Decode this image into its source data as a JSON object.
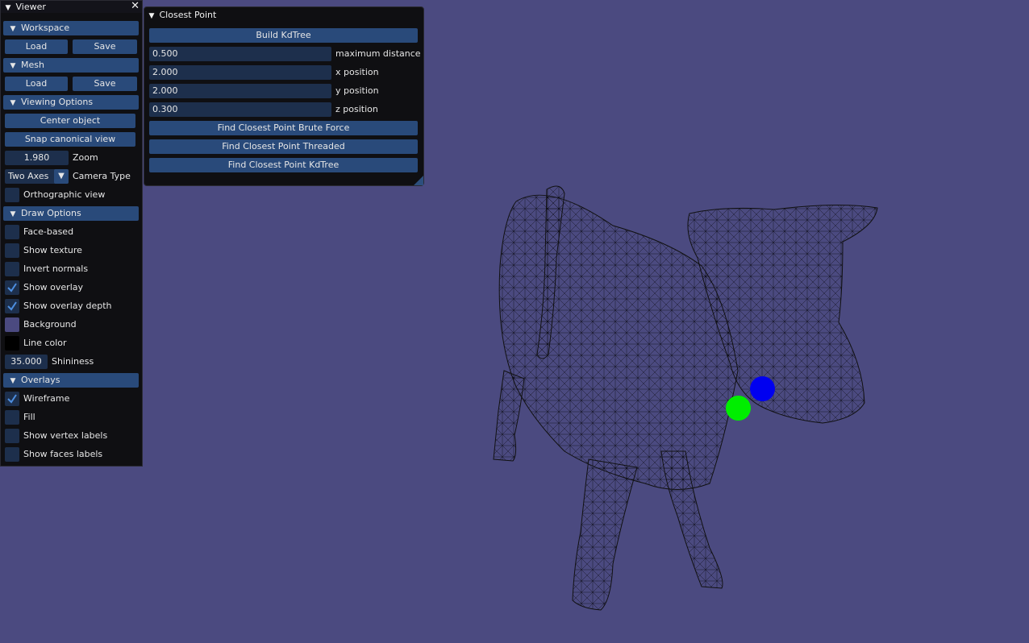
{
  "viewer": {
    "title": "Viewer",
    "close_icon": "close-icon",
    "workspace": {
      "header": "Workspace",
      "load": "Load",
      "save": "Save"
    },
    "mesh": {
      "header": "Mesh",
      "load": "Load",
      "save": "Save"
    },
    "viewing": {
      "header": "Viewing Options",
      "center": "Center object",
      "snap": "Snap canonical view",
      "zoom_value": "1.980",
      "zoom_label": "Zoom",
      "camera_value": "Two Axes",
      "camera_label": "Camera Type",
      "ortho_label": "Orthographic view",
      "ortho_checked": false
    },
    "draw": {
      "header": "Draw Options",
      "face_based": "Face-based",
      "show_texture": "Show texture",
      "invert_normals": "Invert normals",
      "show_overlay": "Show overlay",
      "show_overlay_depth": "Show overlay depth",
      "background": "Background",
      "background_color": "#4b4a80",
      "line_color": "Line color",
      "line_color_value": "#000000",
      "shininess_value": "35.000",
      "shininess_label": "Shininess"
    },
    "overlays": {
      "header": "Overlays",
      "wireframe": "Wireframe",
      "fill": "Fill",
      "vertex_labels": "Show vertex labels",
      "face_labels": "Show faces labels"
    }
  },
  "closest": {
    "title": "Closest Point",
    "build": "Build KdTree",
    "max_dist_value": "0.500",
    "max_dist_label": "maximum distance",
    "x_value": "2.000",
    "x_label": "x position",
    "y_value": "2.000",
    "y_label": "y position",
    "z_value": "0.300",
    "z_label": "z position",
    "brute": "Find Closest Point Brute Force",
    "threaded": "Find Closest Point Threaded",
    "kdtree": "Find Closest Point KdTree"
  },
  "scene": {
    "background": "#4b4a80",
    "query_point_color": "#0000ff",
    "closest_point_color": "#00ee00"
  }
}
